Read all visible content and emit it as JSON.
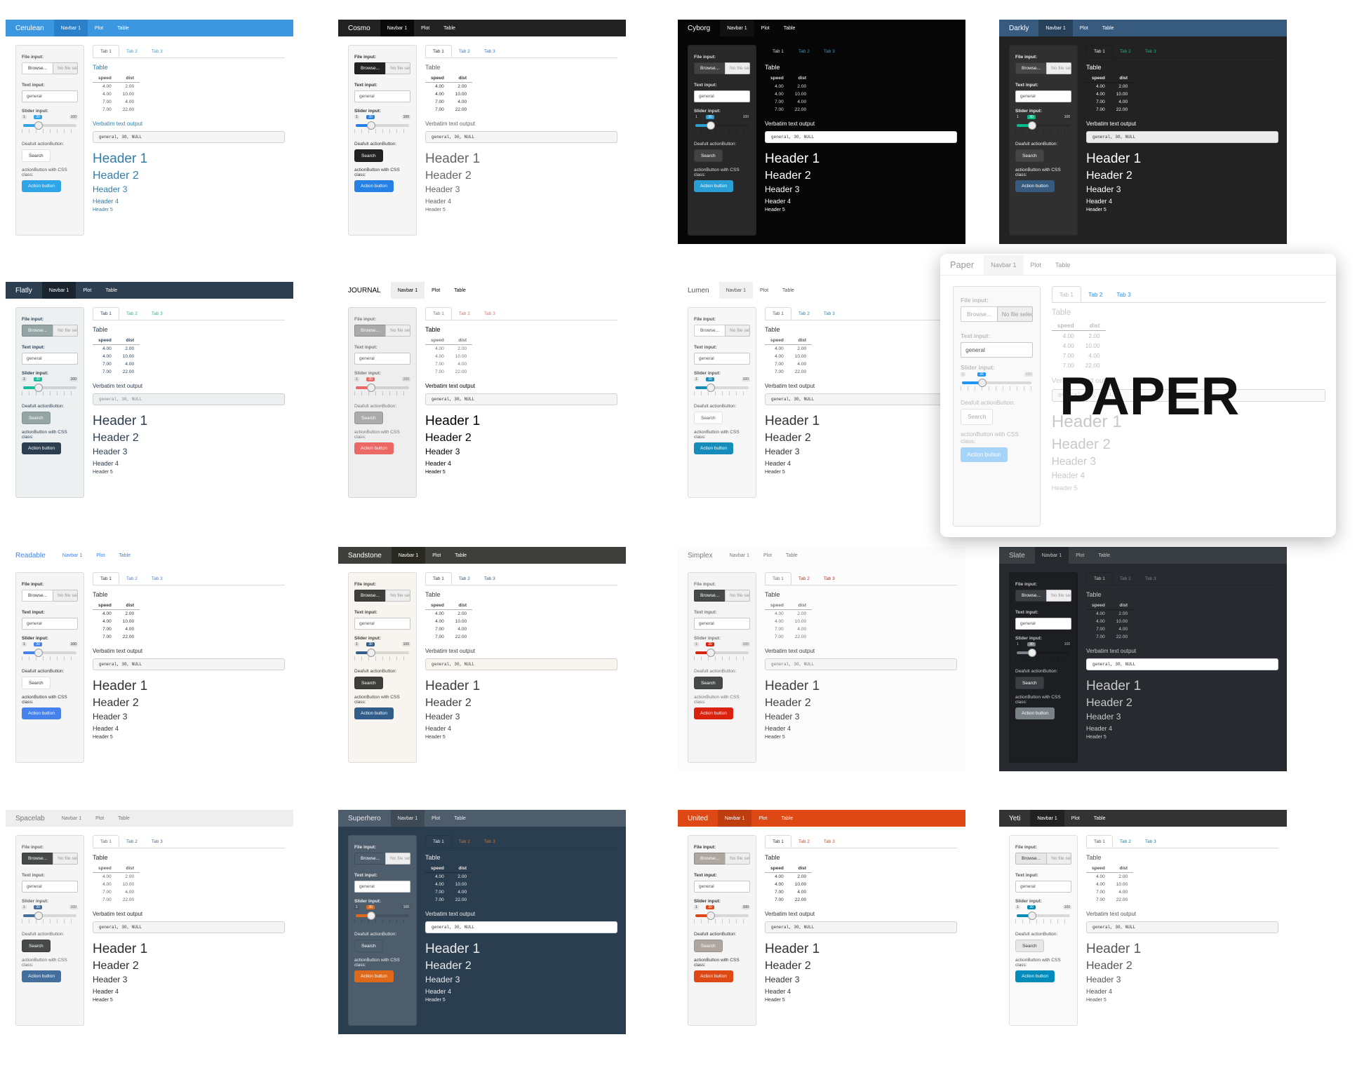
{
  "common": {
    "navbar_items": [
      "Navbar 1",
      "Plot",
      "Table"
    ],
    "file_label": "File input:",
    "browse": "Browse...",
    "no_file": "No file selected",
    "text_label": "Text input:",
    "text_value": "general",
    "slider_label": "Slider input:",
    "slider_min": "1",
    "slider_value": "30",
    "slider_max": "100",
    "slider_fraction": 0.29,
    "default_btn_label": "Deafult actionButton:",
    "search": "Search",
    "css_btn_label": "actionButton with CSS class:",
    "action_button": "Action button",
    "tabs": [
      "Tab 1",
      "Tab 2",
      "Tab 3"
    ],
    "table_title": "Table",
    "table_headers": [
      "speed",
      "dist"
    ],
    "table_rows": [
      [
        "4.00",
        "2.00"
      ],
      [
        "4.00",
        "10.00"
      ],
      [
        "7.00",
        "4.00"
      ],
      [
        "7.00",
        "22.00"
      ]
    ],
    "verbatim_title": "Verbatim text output",
    "verbatim_text": "general, 30, NULL",
    "headers": [
      "Header 1",
      "Header 2",
      "Header 3",
      "Header 4",
      "Header 5"
    ]
  },
  "overlay_label": "PAPER",
  "themes": [
    {
      "name": "Cerulean",
      "nav_bg": "#3b97e0",
      "nav_fg": "#ffffff",
      "active_bg": "#2a80c9",
      "page_bg": "#ffffff",
      "well_bg": "#f5f5f5",
      "text": "#555555",
      "accent": "#2fa4e7",
      "heading": "#317eac",
      "btn_default_bg": "#ffffff",
      "btn_default_fg": "#333333",
      "btn_primary_bg": "#2fa4e7",
      "btn_primary_fg": "#ffffff",
      "input_bg": "#ffffff",
      "pre_bg": "#f5f5f5",
      "pre_fg": "#333333"
    },
    {
      "name": "Cosmo",
      "nav_bg": "#222222",
      "nav_fg": "#ffffff",
      "active_bg": "#090909",
      "page_bg": "#ffffff",
      "well_bg": "#f5f5f5",
      "text": "#333333",
      "accent": "#2780e3",
      "heading": "#666666",
      "btn_default_bg": "#222222",
      "btn_default_fg": "#ffffff",
      "btn_primary_bg": "#2780e3",
      "btn_primary_fg": "#ffffff",
      "input_bg": "#ffffff",
      "pre_bg": "#f5f5f5",
      "pre_fg": "#333333"
    },
    {
      "name": "Cyborg",
      "nav_bg": "#060606",
      "nav_fg": "#ffffff",
      "active_bg": "#111111",
      "page_bg": "#060606",
      "well_bg": "#282828",
      "text": "#dddddd",
      "accent": "#2a9fd6",
      "heading": "#ffffff",
      "btn_default_bg": "#424242",
      "btn_default_fg": "#ffffff",
      "btn_primary_bg": "#2a9fd6",
      "btn_primary_fg": "#ffffff",
      "input_bg": "#ffffff",
      "pre_bg": "#ffffff",
      "pre_fg": "#333333"
    },
    {
      "name": "Darkly",
      "nav_bg": "#375a7f",
      "nav_fg": "#ffffff",
      "active_bg": "#28415b",
      "page_bg": "#222222",
      "well_bg": "#303030",
      "text": "#eeeeee",
      "accent": "#00bc8c",
      "heading": "#ffffff",
      "btn_default_bg": "#464545",
      "btn_default_fg": "#ffffff",
      "btn_primary_bg": "#375a7f",
      "btn_primary_fg": "#ffffff",
      "input_bg": "#ffffff",
      "pre_bg": "#ebebeb",
      "pre_fg": "#333333"
    },
    {
      "name": "Flatly",
      "nav_bg": "#2c3e50",
      "nav_fg": "#ffffff",
      "active_bg": "#1a242f",
      "page_bg": "#ffffff",
      "well_bg": "#ecf0f1",
      "text": "#2c3e50",
      "accent": "#18bc9c",
      "heading": "#2c3e50",
      "btn_default_bg": "#95a5a6",
      "btn_default_fg": "#ffffff",
      "btn_primary_bg": "#2c3e50",
      "btn_primary_fg": "#ffffff",
      "input_bg": "#ffffff",
      "pre_bg": "#ecf0f1",
      "pre_fg": "#7b8a8b"
    },
    {
      "name": "JOURNAL",
      "nav_bg": "#ffffff",
      "nav_fg": "#000000",
      "active_bg": "#eeeeee",
      "page_bg": "#ffffff",
      "well_bg": "#eeeeee",
      "text": "#777777",
      "accent": "#eb6864",
      "heading": "#000000",
      "btn_default_bg": "#aaaaaa",
      "btn_default_fg": "#ffffff",
      "btn_primary_bg": "#eb6864",
      "btn_primary_fg": "#ffffff",
      "input_bg": "#ffffff",
      "pre_bg": "#f5f5f5",
      "pre_fg": "#333333"
    },
    {
      "name": "Lumen",
      "nav_bg": "#ffffff",
      "nav_fg": "#555555",
      "active_bg": "#f0f0f0",
      "page_bg": "#ffffff",
      "well_bg": "#f7f7f7",
      "text": "#555555",
      "accent": "#158cba",
      "heading": "#333333",
      "btn_default_bg": "#ffffff",
      "btn_default_fg": "#555555",
      "btn_primary_bg": "#158cba",
      "btn_primary_fg": "#ffffff",
      "input_bg": "#ffffff",
      "pre_bg": "#f5f5f5",
      "pre_fg": "#333333"
    },
    {
      "name": "Paper",
      "nav_bg": "#ffffff",
      "nav_fg": "#999999",
      "active_bg": "#f5f5f5",
      "page_bg": "#ffffff",
      "well_bg": "#f9f9f9",
      "text": "#bbbbbb",
      "accent": "#2196f3",
      "heading": "#c8c8c8",
      "btn_default_bg": "#ffffff",
      "btn_default_fg": "#aaaaaa",
      "btn_primary_bg": "#a6d3f8",
      "btn_primary_fg": "#ffffff",
      "input_bg": "#ffffff",
      "pre_bg": "#fafafa",
      "pre_fg": "#cccccc"
    },
    {
      "name": "Readable",
      "nav_bg": "#ffffff",
      "nav_fg": "#4582ec",
      "active_bg": "#ffffff",
      "page_bg": "#ffffff",
      "well_bg": "#f5f5f5",
      "text": "#333333",
      "accent": "#4582ec",
      "heading": "#333333",
      "btn_default_bg": "#ffffff",
      "btn_default_fg": "#333333",
      "btn_primary_bg": "#4582ec",
      "btn_primary_fg": "#ffffff",
      "input_bg": "#ffffff",
      "pre_bg": "#f5f5f5",
      "pre_fg": "#333333"
    },
    {
      "name": "Sandstone",
      "nav_bg": "#3e3f3a",
      "nav_fg": "#ffffff",
      "active_bg": "#29291f",
      "page_bg": "#ffffff",
      "well_bg": "#f8f5f0",
      "text": "#3e3f3a",
      "accent": "#325d88",
      "heading": "#3e3f3a",
      "btn_default_bg": "#3e3f3a",
      "btn_default_fg": "#ffffff",
      "btn_primary_bg": "#325d88",
      "btn_primary_fg": "#ffffff",
      "input_bg": "#ffffff",
      "pre_bg": "#f8f5f0",
      "pre_fg": "#3e3f3a"
    },
    {
      "name": "Simplex",
      "nav_bg": "#fcfcfc",
      "nav_fg": "#777777",
      "active_bg": "#fcfcfc",
      "page_bg": "#fcfcfc",
      "well_bg": "#f4f4f4",
      "text": "#777777",
      "accent": "#d9230f",
      "heading": "#404040",
      "btn_default_bg": "#474949",
      "btn_default_fg": "#ffffff",
      "btn_primary_bg": "#d9230f",
      "btn_primary_fg": "#ffffff",
      "input_bg": "#ffffff",
      "pre_bg": "#f5f5f5",
      "pre_fg": "#777777"
    },
    {
      "name": "Slate",
      "nav_bg": "#3a3f44",
      "nav_fg": "#c8c8c8",
      "active_bg": "#272b30",
      "page_bg": "#272b30",
      "well_bg": "#1c1e22",
      "text": "#c8c8c8",
      "accent": "#7a8288",
      "heading": "#c8c8c8",
      "btn_default_bg": "#3a3f44",
      "btn_default_fg": "#ffffff",
      "btn_primary_bg": "#7a8288",
      "btn_primary_fg": "#ffffff",
      "input_bg": "#ffffff",
      "pre_bg": "#ffffff",
      "pre_fg": "#333333"
    },
    {
      "name": "Spacelab",
      "nav_bg": "#eeeeee",
      "nav_fg": "#777777",
      "active_bg": "#eeeeee",
      "page_bg": "#ffffff",
      "well_bg": "#f5f5f5",
      "text": "#666666",
      "accent": "#446e9b",
      "heading": "#2d2d2d",
      "btn_default_bg": "#474949",
      "btn_default_fg": "#ffffff",
      "btn_primary_bg": "#446e9b",
      "btn_primary_fg": "#ffffff",
      "input_bg": "#ffffff",
      "pre_bg": "#f5f5f5",
      "pre_fg": "#333333"
    },
    {
      "name": "Superhero",
      "nav_bg": "#4e5d6c",
      "nav_fg": "#ebebeb",
      "active_bg": "#3e4a56",
      "page_bg": "#2b3e50",
      "well_bg": "#4e5d6c",
      "text": "#ebebeb",
      "accent": "#df691a",
      "heading": "#ebebeb",
      "btn_default_bg": "#4e5d6c",
      "btn_default_fg": "#ffffff",
      "btn_primary_bg": "#df691a",
      "btn_primary_fg": "#ffffff",
      "input_bg": "#ffffff",
      "pre_bg": "#ffffff",
      "pre_fg": "#333333"
    },
    {
      "name": "United",
      "nav_bg": "#dd4814",
      "nav_fg": "#ffffff",
      "active_bg": "#be3e11",
      "page_bg": "#ffffff",
      "well_bg": "#f5f5f5",
      "text": "#333333",
      "accent": "#dd4814",
      "heading": "#333333",
      "btn_default_bg": "#aea79f",
      "btn_default_fg": "#ffffff",
      "btn_primary_bg": "#dd4814",
      "btn_primary_fg": "#ffffff",
      "input_bg": "#ffffff",
      "pre_bg": "#f5f5f5",
      "pre_fg": "#333333"
    },
    {
      "name": "Yeti",
      "nav_bg": "#333333",
      "nav_fg": "#ffffff",
      "active_bg": "#222222",
      "page_bg": "#ffffff",
      "well_bg": "#fafafa",
      "text": "#555555",
      "accent": "#008cba",
      "heading": "#555555",
      "btn_default_bg": "#e7e7e7",
      "btn_default_fg": "#333333",
      "btn_primary_bg": "#008cba",
      "btn_primary_fg": "#ffffff",
      "input_bg": "#ffffff",
      "pre_bg": "#f5f5f5",
      "pre_fg": "#333333"
    }
  ]
}
